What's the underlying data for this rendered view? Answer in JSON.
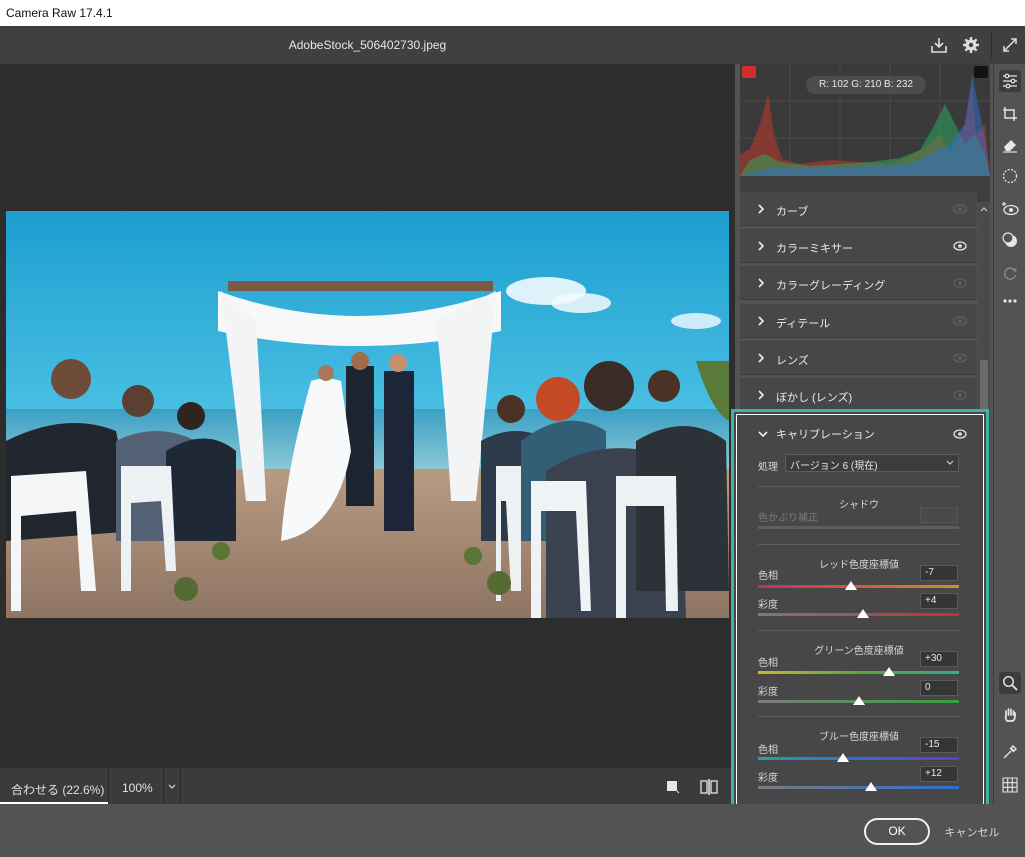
{
  "app": {
    "title": "Camera Raw 17.4.1"
  },
  "header": {
    "filename": "AdobeStock_506402730.jpeg"
  },
  "histogram": {
    "readout": "R: 102   G: 210   B: 232"
  },
  "sections": [
    {
      "label": "カーブ"
    },
    {
      "label": "カラーミキサー"
    },
    {
      "label": "カラーグレーディング"
    },
    {
      "label": "ディテール"
    },
    {
      "label": "レンズ"
    },
    {
      "label": "ぼかし (レンズ)"
    }
  ],
  "calibration": {
    "title": "キャリブレーション",
    "process_label": "処理",
    "process_value": "バージョン 6 (現在)",
    "shadow": {
      "heading": "シャドウ",
      "tint_label": "色かぶり補正",
      "tint_value": ""
    },
    "red": {
      "heading": "レッド色度座標値",
      "hue_label": "色相",
      "hue_value": "-7",
      "hue_level": -7,
      "sat_label": "彩度",
      "sat_value": "+4",
      "sat_level": 4
    },
    "green": {
      "heading": "グリーン色度座標値",
      "hue_label": "色相",
      "hue_value": "+30",
      "hue_level": 30,
      "sat_label": "彩度",
      "sat_value": "0",
      "sat_level": 0
    },
    "blue": {
      "heading": "ブルー色度座標値",
      "hue_label": "色相",
      "hue_value": "-15",
      "hue_level": -15,
      "sat_label": "彩度",
      "sat_value": "+12",
      "sat_level": 12
    }
  },
  "zoom": {
    "fit_label": "合わせる (22.6%)",
    "percent_label": "100%"
  },
  "footer": {
    "ok_label": "OK",
    "cancel_label": "キャンセル"
  },
  "colors": {
    "accent_highlight": "#3fb4a6",
    "panel_bg": "#474747",
    "preview_bg": "#2d2d2d"
  },
  "icons": {
    "header": [
      "save-icon",
      "gear-icon",
      "fullscreen-icon"
    ],
    "tools": [
      "edit-sliders-icon",
      "crop-icon",
      "eraser-icon",
      "mask-icon",
      "redeye-icon",
      "presets-icon",
      "snapshot-icon",
      "more-icon",
      "zoom-icon",
      "hand-icon",
      "eyedropper-icon",
      "grid-icon"
    ]
  }
}
